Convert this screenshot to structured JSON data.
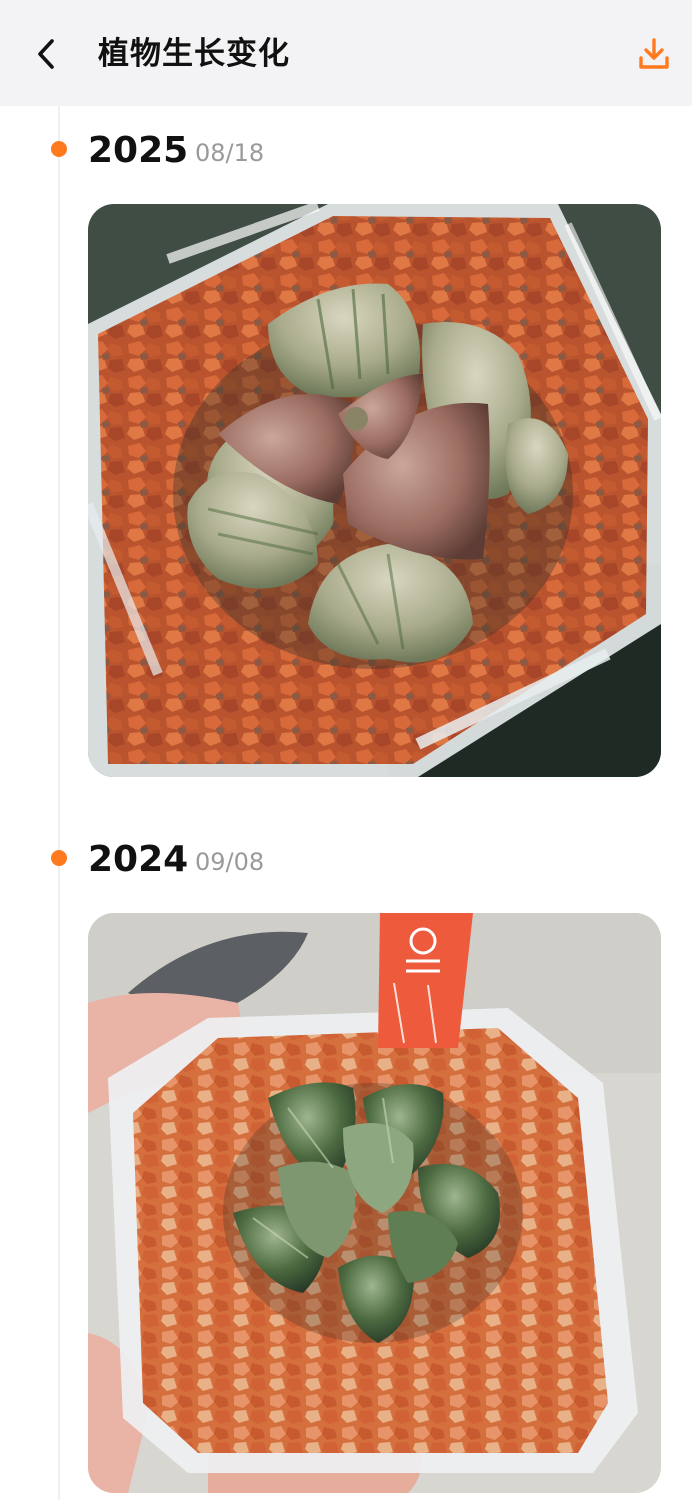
{
  "header": {
    "back_icon": "chevron-left-icon",
    "title": "植物生长变化",
    "download_icon": "download-icon",
    "accent_color": "#ff7a1f"
  },
  "timeline": {
    "entries": [
      {
        "year": "2025",
        "date": "08/18",
        "photo_alt": "Succulent (Haworthia) in a clear square pot with red pumice"
      },
      {
        "year": "2024",
        "date": "09/08",
        "photo_alt": "Young Haworthia in a clear square pot with orange plant tag"
      }
    ]
  }
}
